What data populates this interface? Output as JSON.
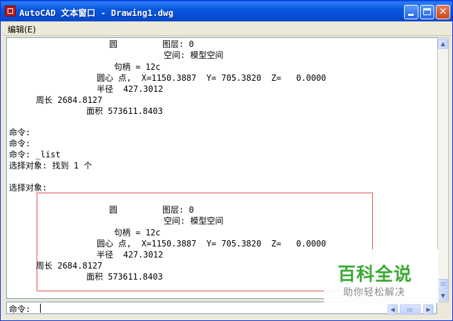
{
  "window": {
    "title": "AutoCAD 文本窗口 - Drawing1.dwg",
    "minimize_glyph": "",
    "close_glyph": "✕"
  },
  "menu": {
    "edit": "编辑(E)"
  },
  "text_lines": [
    "圆         图层: 0",
    "空间: 模型空间",
    "句柄 = 12c",
    "圆心 点,  X=1150.3887  Y= 705.3820  Z=   0.0000",
    "半径  427.3012",
    "周长 2684.8127",
    "面积 573611.8403",
    "命令:",
    "命令:",
    "命令: _list",
    "选择对象: 找到 1 个",
    "选择对象:",
    "圆         图层: 0",
    "空间: 模型空间",
    "句柄 = 12c",
    "圆心 点,  X=1150.3887  Y= 705.3820  Z=   0.0000",
    "半径  427.3012",
    "周长 2684.8127",
    "面积 573611.8403"
  ],
  "command_prompt": "命令:",
  "watermark": {
    "main": "百科全说",
    "sub": "助你轻松解决"
  },
  "colors": {
    "title_bar": "#0a5ae8",
    "highlight_box": "#e05050",
    "watermark_green": "#3aaa35"
  }
}
